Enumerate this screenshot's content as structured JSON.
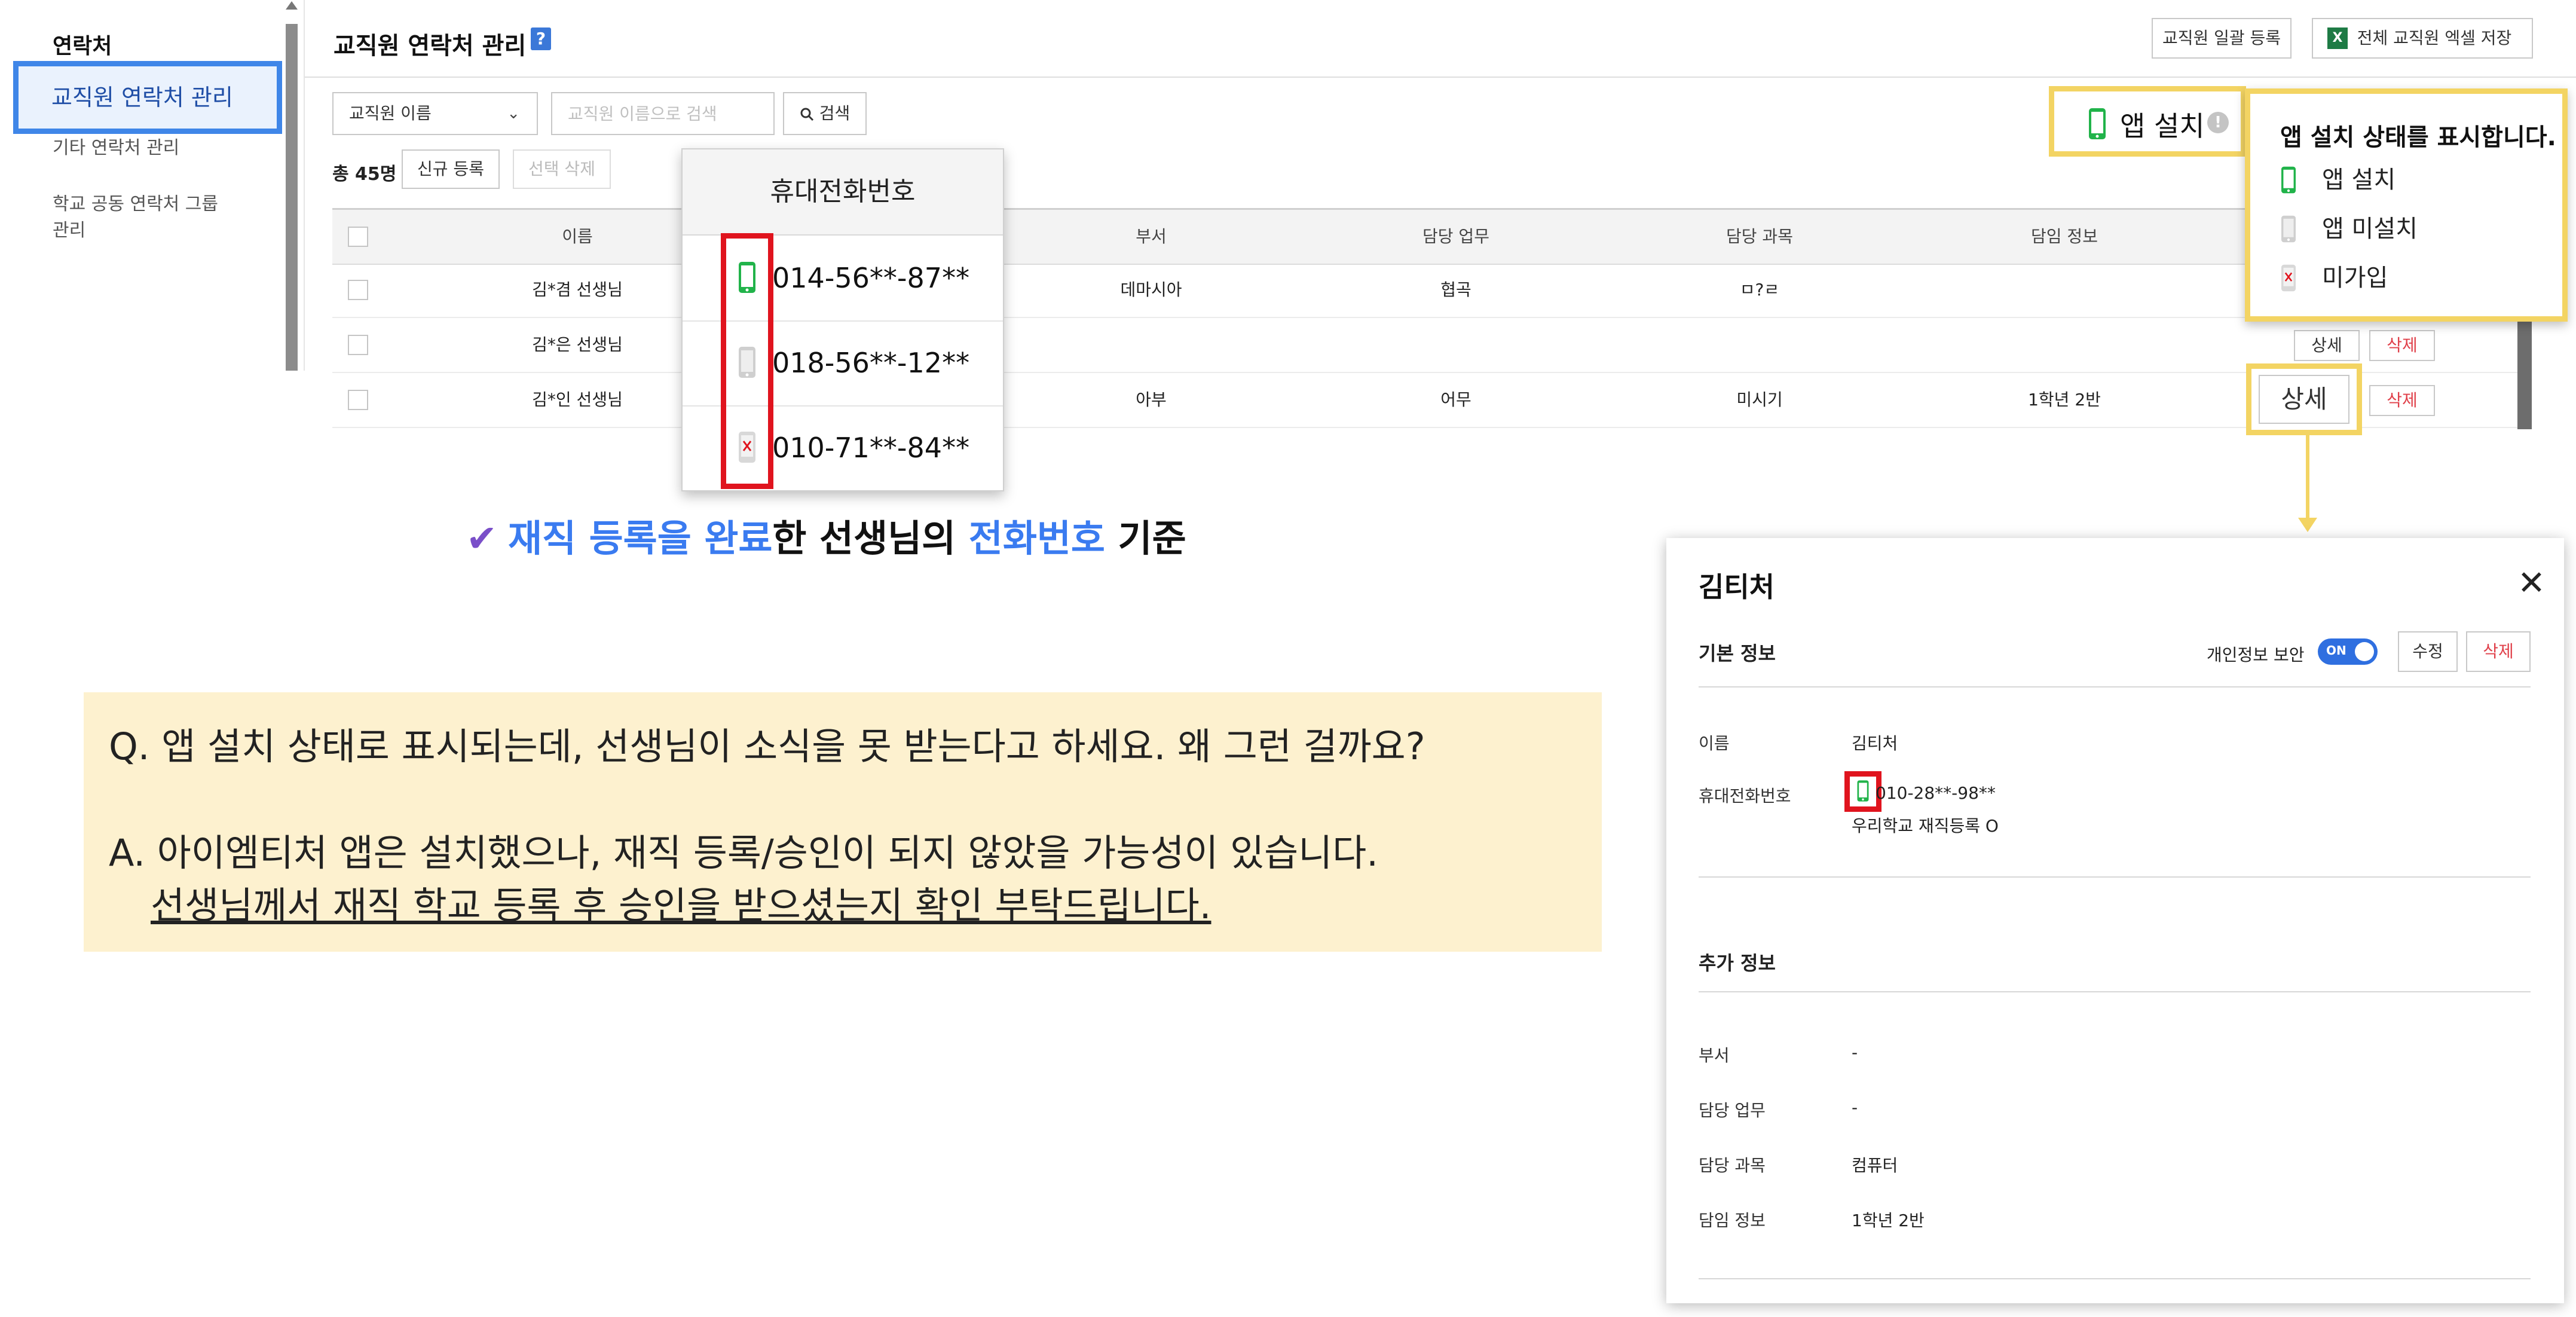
{
  "sidebar": {
    "title": "연락처",
    "items": [
      "교직원 연락처 관리",
      "기타 연락처 관리",
      "학교 공동 연락처 그룹",
      "관리"
    ]
  },
  "header": {
    "title": "교직원 연락처 관리",
    "help_icon": "?",
    "bulk_register": "교직원 일괄 등록",
    "excel_save": "전체 교직원 엑셀 저장"
  },
  "search": {
    "select_value": "교직원 이름",
    "placeholder": "교직원 이름으로 검색",
    "button": "검색"
  },
  "list": {
    "total": "총 45명",
    "new_button": "신규 등록",
    "delete_selected": "선택 삭제"
  },
  "table": {
    "headers": [
      "이름",
      "부서",
      "담당 업무",
      "담당 과목",
      "담임 정보"
    ],
    "rows": [
      {
        "name": "김*겸 선생님",
        "dept": "데마시아",
        "duty": "협곡",
        "subject": "ㅁ?ㄹ",
        "homeroom": ""
      },
      {
        "name": "김*은 선생님",
        "dept": "",
        "duty": "",
        "subject": "",
        "homeroom": ""
      },
      {
        "name": "김*인 선생님",
        "dept": "아부",
        "duty": "어무",
        "subject": "미시기",
        "homeroom": "1학년 2반"
      }
    ],
    "detail_button": "상세",
    "delete_button": "삭제"
  },
  "phone_popover": {
    "title": "휴대전화번호",
    "numbers": [
      "014-56**-87**",
      "018-56**-12**",
      "010-71**-84**"
    ],
    "status_icons": [
      "phone-installed-icon",
      "phone-not-installed-icon",
      "phone-not-joined-icon"
    ]
  },
  "app_status": {
    "label": "앱 설치",
    "info_icon": "!"
  },
  "legend": {
    "title": "앱 설치 상태를 표시합니다.",
    "items": [
      "앱 설치",
      "앱 미설치",
      "미가입"
    ]
  },
  "caption": {
    "part1": "재직 등록을 완료",
    "part2": "한 선생님의 ",
    "part3": "전화번호",
    "part4": " 기준"
  },
  "qa": {
    "question": "Q. 앱 설치 상태로 표시되는데, 선생님이 소식을 못 받는다고 하세요. 왜 그런 걸까요?",
    "answer_line1": "A. 아이엠티처 앱은 설치했으나, 재직 등록/승인이 되지 않았을 가능성이 있습니다.",
    "answer_line2": "선생님께서 재직 학교 등록 후 승인을 받으셨는지 확인 부탁드립니다."
  },
  "detail_panel": {
    "title": "김티처",
    "basic_section": "기본 정보",
    "privacy_label": "개인정보 보안",
    "toggle_on": "ON",
    "edit_button": "수정",
    "delete_button": "삭제",
    "name_label": "이름",
    "name_value": "김티처",
    "phone_label": "휴대전화번호",
    "phone_value": "010-28**-98**",
    "school_link": "우리학교 재직등록 O",
    "extra_section": "추가 정보",
    "fields": [
      {
        "label": "부서",
        "value": "-"
      },
      {
        "label": "담당 업무",
        "value": "-"
      },
      {
        "label": "담당 과목",
        "value": "컴퓨터"
      },
      {
        "label": "담임 정보",
        "value": "1학년 2반"
      }
    ]
  },
  "colors": {
    "accent_blue": "#3a7bf0",
    "highlight_red": "#e0141e",
    "highlight_yellow": "#f3d463",
    "app_installed_green": "#21b34a",
    "qa_background": "#fdf1cf"
  }
}
